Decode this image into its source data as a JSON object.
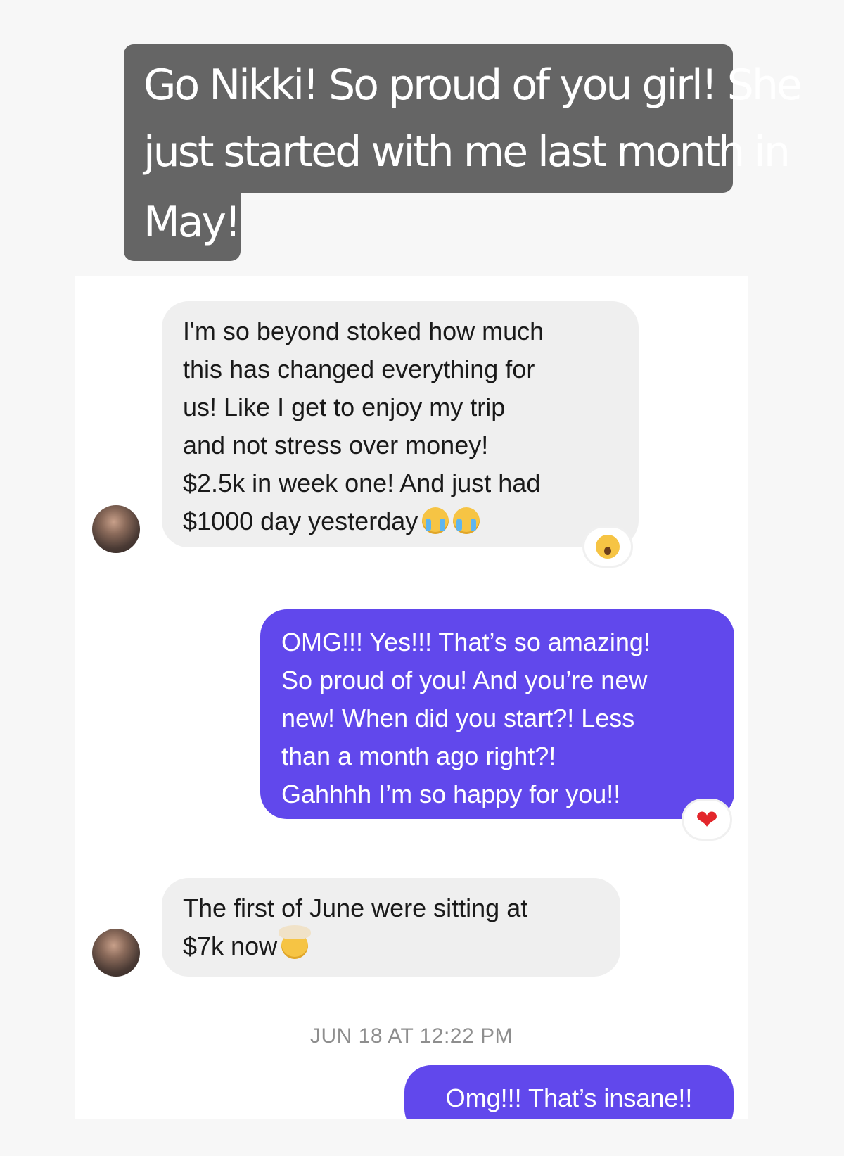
{
  "caption": {
    "line1": "Go Nikki! So proud of you girl! She",
    "line2": "just started with me last month in",
    "line3": "May!"
  },
  "messages": [
    {
      "lines": [
        "I'm so beyond stoked how much",
        "this has changed everything for",
        "us! Like I get to enjoy my trip",
        "and not stress over money!",
        "$2.5k in week one! And just had",
        "$1000 day yesterday"
      ],
      "emoji": [
        "loudly-crying-face",
        "loudly-crying-face"
      ],
      "reaction": "astonished-face"
    },
    {
      "lines": [
        "OMG!!! Yes!!! That’s so amazing!",
        "So proud of you! And you’re new",
        "new! When did you start?! Less",
        "than a month ago right?!",
        "Gahhhh I’m so happy for you!!"
      ],
      "reaction": "❤"
    },
    {
      "lines": [
        "The first of June were sitting at",
        "$7k now"
      ],
      "emoji": [
        "exploding-head"
      ]
    },
    {
      "lines": [
        "Omg!!! That’s insane!!"
      ]
    }
  ],
  "timestamp": "JUN 18 AT 12:22 PM",
  "colors": {
    "outgoing": "#6148ec",
    "incoming": "#efefef",
    "caption_bg": "#656565"
  }
}
